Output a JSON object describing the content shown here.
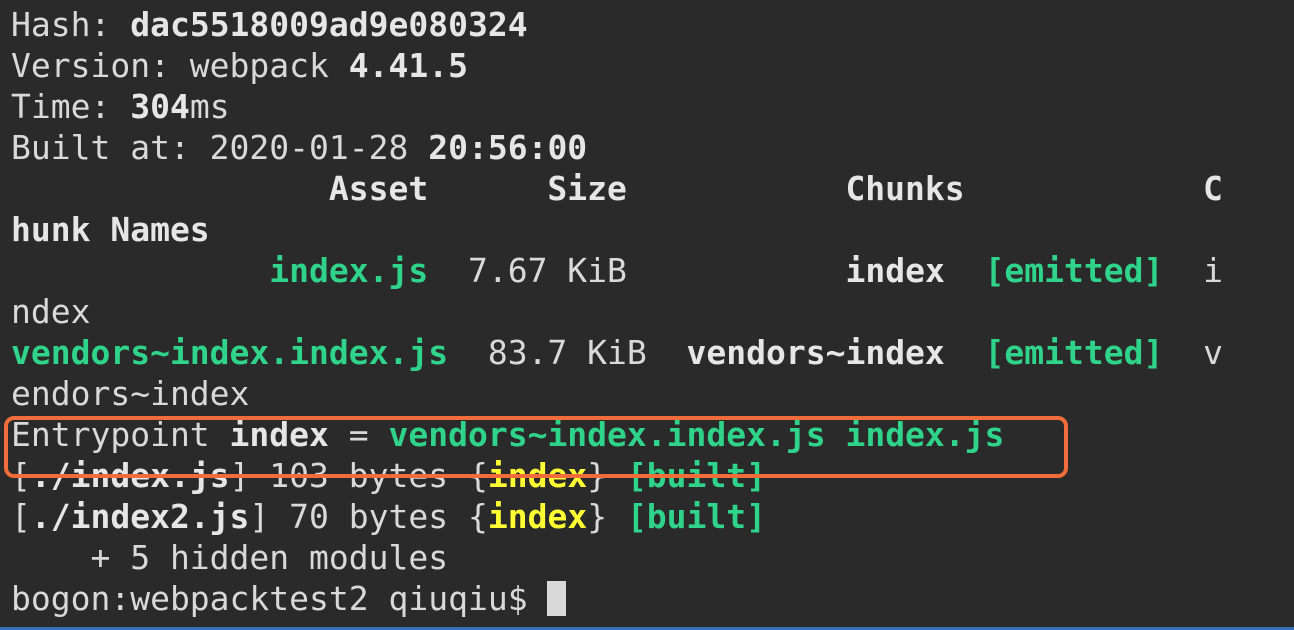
{
  "terminal": {
    "hash_label": "Hash: ",
    "hash_value": "dac5518009ad9e080324",
    "version_label": "Version: webpack ",
    "version_value": "4.41.5",
    "time_label": "Time: ",
    "time_value": "304",
    "time_unit": "ms",
    "built_label": "Built at: 2020-01-28 ",
    "built_time": "20:56:00",
    "table_header": "                Asset      Size           Chunks            C",
    "table_header_wrap": "hunk Names",
    "row1_pad": "             ",
    "row1_asset": "index.js",
    "row1_size": "  7.67 KiB           ",
    "row1_chunks": "index",
    "row1_gap": "  ",
    "row1_status": "[emitted]",
    "row1_tail": "  i",
    "row1_wrap": "ndex",
    "row2_asset": "vendors~index.index.js",
    "row2_size": "  83.7 KiB  ",
    "row2_chunks": "vendors~index",
    "row2_gap": "  ",
    "row2_status": "[emitted]",
    "row2_tail": "  v",
    "row2_wrap": "endors~index",
    "entry_label": "Entrypoint ",
    "entry_name": "index",
    "entry_eq": " = ",
    "entry_files": "vendors~index.index.js index.js",
    "mod1_open": "[",
    "mod1_path": "./index.js",
    "mod1_mid": "] 103 bytes {",
    "mod1_chunk": "index",
    "mod1_close": "} ",
    "mod1_status": "[built]",
    "mod2_open": "[",
    "mod2_path": "./index2.js",
    "mod2_mid": "] 70 bytes {",
    "mod2_chunk": "index",
    "mod2_close": "} ",
    "mod2_status": "[built]",
    "hidden_modules": "    + 5 hidden modules",
    "prompt": "bogon:webpacktest2 qiuqiu$ "
  },
  "colors": {
    "background": "#2a2a2a",
    "text": "#d9d9d9",
    "green": "#2fd48a",
    "yellow": "#ffff33",
    "highlight": "#f06c3a"
  }
}
